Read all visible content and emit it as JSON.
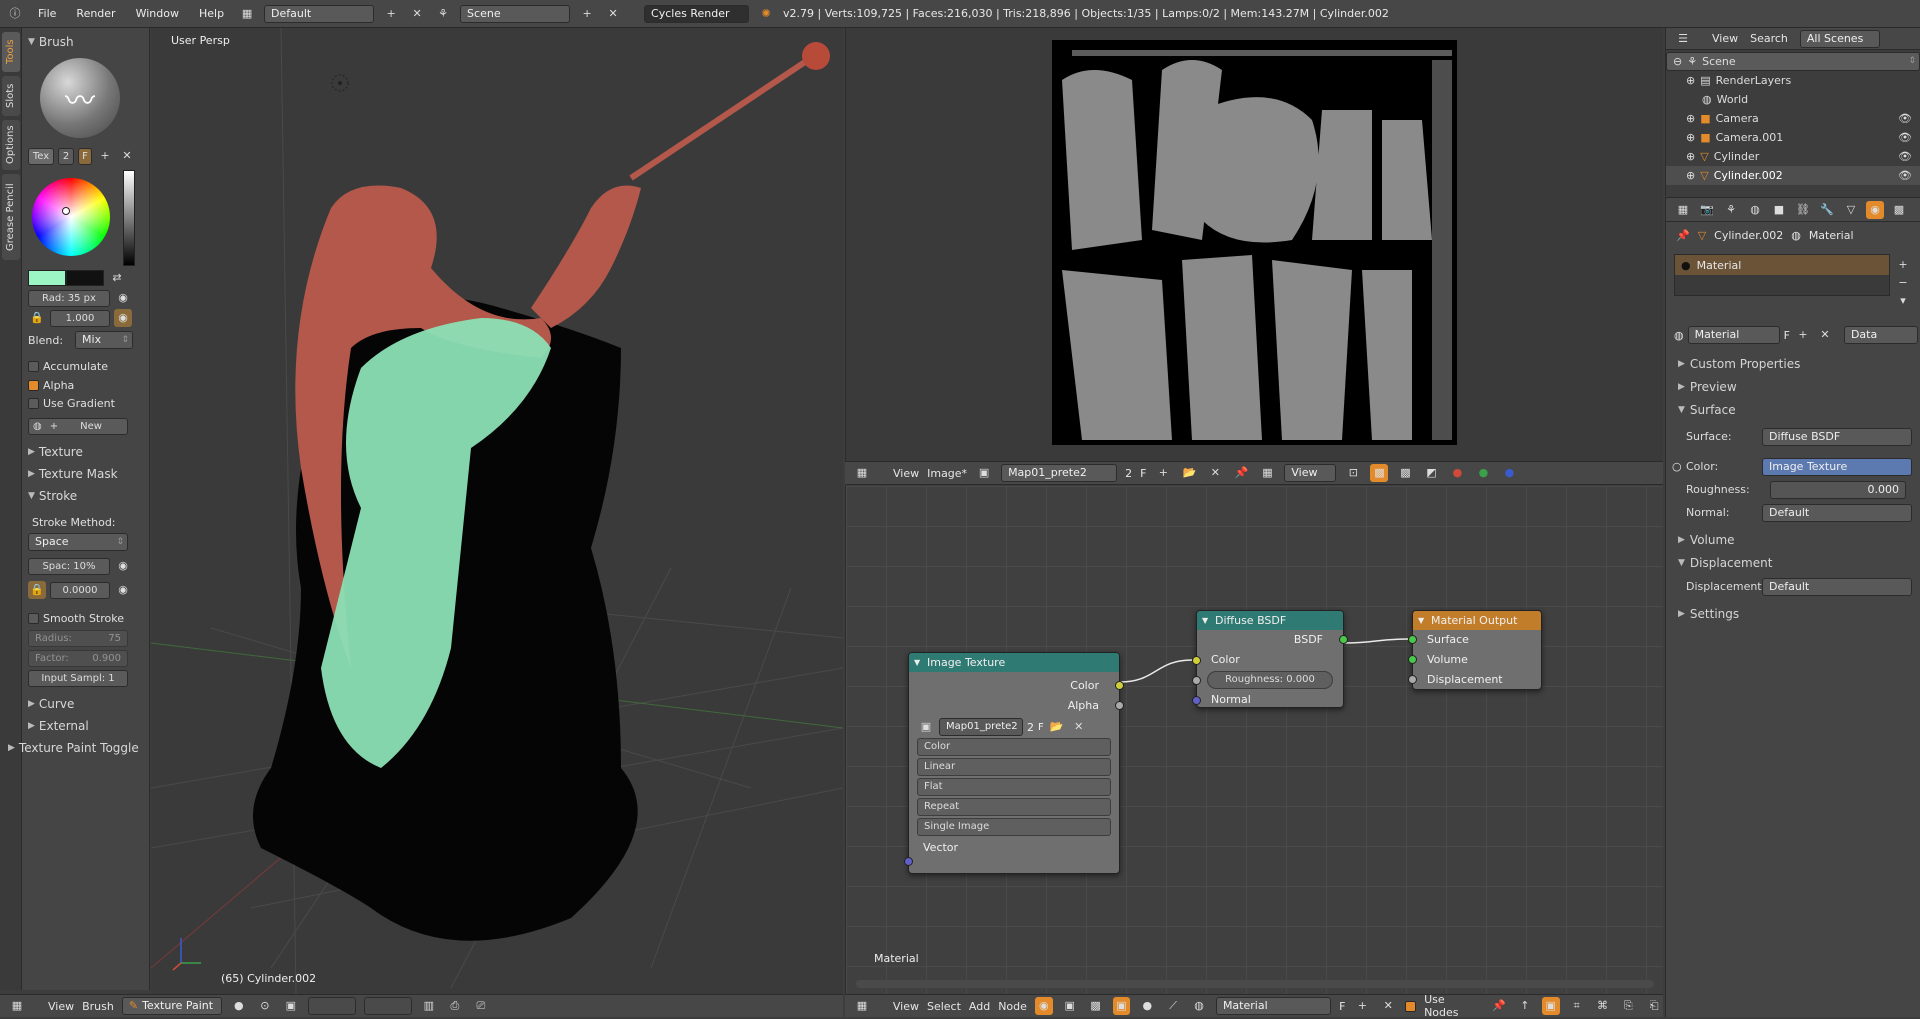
{
  "topbar": {
    "menus": [
      "File",
      "Render",
      "Window",
      "Help"
    ],
    "layout": "Default",
    "scene": "Scene",
    "engine": "Cycles Render",
    "stats": "v2.79 | Verts:109,725 | Faces:216,030 | Tris:218,896 | Objects:1/35 | Lamps:0/2 | Mem:143.27M | Cylinder.002"
  },
  "shelf": {
    "tabs": [
      "Tools",
      "Slots",
      "Options",
      "Grease Pencil"
    ],
    "brush_title": "Brush",
    "tex_label": "Tex",
    "tex_users": "2",
    "tex_fake": "F",
    "radius": "Rad: 35 px",
    "strength": "1.000",
    "blend_label": "Blend:",
    "blend_value": "Mix",
    "accumulate": "Accumulate",
    "alpha": "Alpha",
    "use_gradient": "Use Gradient",
    "new_label": "New",
    "texture": "Texture",
    "texture_mask": "Texture Mask",
    "stroke": "Stroke",
    "stroke_method_label": "Stroke Method:",
    "stroke_method": "Space",
    "spacing": "Spac: 10%",
    "jitter": "0.0000",
    "smooth_stroke": "Smooth Stroke",
    "smooth_radius": "Radius:",
    "smooth_radius_val": "75",
    "smooth_factor": "Factor:",
    "smooth_factor_val": "0.900",
    "input_samples": "Input Sampl: 1",
    "curve": "Curve",
    "external": "External",
    "texture_paint_toggle": "Texture Paint Toggle"
  },
  "view3d": {
    "label": "User Persp",
    "object_label": "(65) Cylinder.002",
    "header": {
      "view": "View",
      "brush": "Brush",
      "mode": "Texture Paint"
    }
  },
  "image_editor": {
    "header": {
      "view": "View",
      "image": "Image*",
      "image_name": "Map01_prete2",
      "users": "2",
      "fake": "F",
      "view2": "View"
    }
  },
  "node_editor": {
    "header": {
      "view": "View",
      "select": "Select",
      "add": "Add",
      "node": "Node",
      "material": "Material",
      "fake": "F",
      "use_nodes": "Use Nodes"
    },
    "footer_label": "Material",
    "image_texture": {
      "title": "Image Texture",
      "out_color": "Color",
      "out_alpha": "Alpha",
      "image": "Map01_prete2",
      "users": "2",
      "fake": "F",
      "options": [
        "Color",
        "Linear",
        "Flat",
        "Repeat",
        "Single Image"
      ],
      "in_vector": "Vector"
    },
    "diffuse": {
      "title": "Diffuse BSDF",
      "out": "BSDF",
      "in_color": "Color",
      "roughness": "Roughness: 0.000",
      "in_normal": "Normal"
    },
    "output": {
      "title": "Material Output",
      "surface": "Surface",
      "volume": "Volume",
      "displacement": "Displacement"
    }
  },
  "outliner": {
    "header": {
      "view": "View",
      "search": "Search",
      "scenes": "All Scenes"
    },
    "items": [
      "Scene",
      "RenderLayers",
      "World",
      "Camera",
      "Camera.001",
      "Cylinder",
      "Cylinder.002"
    ]
  },
  "properties": {
    "breadcrumb_obj": "Cylinder.002",
    "breadcrumb_mat": "Material",
    "slot": "Material",
    "material_name": "Material",
    "material_fake": "F",
    "link": "Data",
    "sections": {
      "custom": "Custom Properties",
      "preview": "Preview",
      "surface": "Surface",
      "volume": "Volume",
      "displacement": "Displacement",
      "settings": "Settings"
    },
    "surface_label": "Surface:",
    "surface_value": "Diffuse BSDF",
    "color_label": "Color:",
    "color_value": "Image Texture",
    "roughness_label": "Roughness:",
    "roughness_value": "0.000",
    "normal_label": "Normal:",
    "normal_value": "Default",
    "disp_label": "Displacement:",
    "disp_value": "Default"
  },
  "colors": {
    "accent": "#e38a2a",
    "selected_field": "#5c7ab0",
    "node_texture_head": "#2f7a72",
    "node_output_head": "#c27d2a",
    "brush_color": "#9cf5c5"
  }
}
